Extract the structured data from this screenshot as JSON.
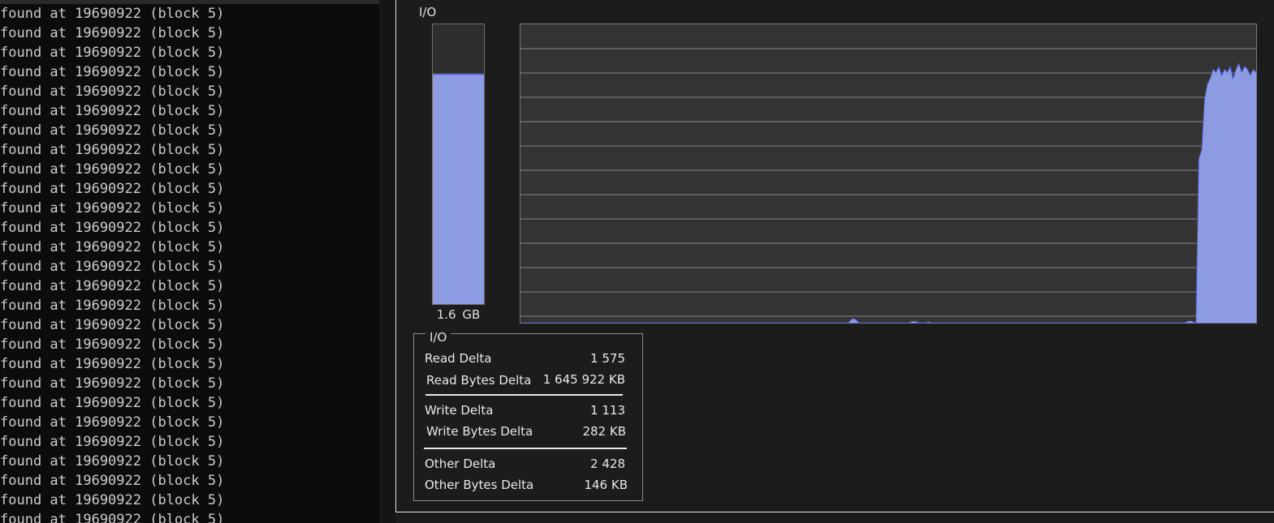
{
  "console": {
    "lines": [
      "found at 19690922 (block 5)",
      "found at 19690922 (block 5)",
      "found at 19690922 (block 5)",
      "found at 19690922 (block 5)",
      "found at 19690922 (block 5)",
      "found at 19690922 (block 5)",
      "found at 19690922 (block 5)",
      "found at 19690922 (block 5)",
      "found at 19690922 (block 5)",
      "found at 19690922 (block 5)",
      "found at 19690922 (block 5)",
      "found at 19690922 (block 5)",
      "found at 19690922 (block 5)",
      "found at 19690922 (block 5)",
      "found at 19690922 (block 5)",
      "found at 19690922 (block 5)",
      "found at 19690922 (block 5)",
      "found at 19690922 (block 5)",
      "found at 19690922 (block 5)",
      "found at 19690922 (block 5)",
      "found at 19690922 (block 5)",
      "found at 19690922 (block 5)",
      "found at 19690922 (block 5)",
      "found at 19690922 (block 5)",
      "found at 19690922 (block 5)",
      "found at 19690922 (block 5)",
      "found at 19690922 (block 5)"
    ]
  },
  "io": {
    "heading": "I/O",
    "meter": {
      "label": "1.6  GB",
      "fill_fraction": 0.82
    },
    "groupbox_title": "I/O",
    "stats": {
      "read_delta": {
        "label": "Read Delta",
        "value": "1 575"
      },
      "read_bytes_delta": {
        "label": "Read Bytes Delta",
        "value": "1 645 922 KB"
      },
      "write_delta": {
        "label": "Write Delta",
        "value": "1 113"
      },
      "write_bytes_delta": {
        "label": "Write Bytes Delta",
        "value": "282 KB"
      },
      "other_delta": {
        "label": "Other Delta",
        "value": "2 428"
      },
      "other_bytes_delta": {
        "label": "Other Bytes Delta",
        "value": "146 KB"
      }
    }
  },
  "graph": {
    "fill_color": "#8d9be3",
    "line_color": "#3a48c8",
    "spike_color": "#cc3388",
    "grid_color": "#8a8a8a",
    "background": "#333333",
    "gridlines": 12,
    "samples": [
      0,
      0,
      0,
      0,
      0,
      0,
      0,
      0,
      0,
      0,
      0,
      0,
      0,
      0,
      0,
      0,
      0,
      0,
      0,
      0,
      0,
      0,
      0,
      0,
      0,
      0,
      0,
      0,
      0,
      0,
      0,
      0,
      0,
      0,
      0,
      0,
      0,
      0,
      0,
      0,
      0,
      0,
      0,
      0,
      0,
      0,
      0,
      0,
      0,
      0,
      0,
      0,
      0,
      0,
      0,
      0,
      0,
      0,
      0,
      0,
      0,
      0,
      0,
      0,
      0,
      0,
      0,
      0,
      0,
      0,
      0,
      0,
      0,
      0,
      0,
      0,
      0,
      0,
      0,
      0,
      0,
      0,
      0,
      0,
      0,
      0,
      0,
      0,
      0,
      0,
      0,
      0,
      0,
      0,
      0,
      0,
      0,
      0,
      0,
      0,
      0,
      0,
      0,
      0,
      0,
      0,
      0,
      0,
      0,
      0,
      0,
      0,
      0,
      0,
      0,
      0.01,
      0.015,
      0.008,
      0,
      0,
      0,
      0,
      0,
      0,
      0,
      0,
      0,
      0,
      0,
      0,
      0,
      0,
      0,
      0,
      0,
      0,
      0.004,
      0.006,
      0.003,
      0,
      0,
      0,
      0.004,
      0,
      0,
      0,
      0,
      0,
      0,
      0,
      0,
      0,
      0,
      0,
      0,
      0,
      0,
      0,
      0,
      0,
      0,
      0,
      0,
      0,
      0,
      0,
      0,
      0,
      0,
      0,
      0,
      0,
      0,
      0,
      0,
      0,
      0,
      0,
      0,
      0,
      0,
      0,
      0,
      0,
      0,
      0,
      0,
      0,
      0,
      0,
      0,
      0,
      0,
      0,
      0,
      0,
      0,
      0,
      0,
      0,
      0,
      0,
      0,
      0,
      0,
      0,
      0,
      0,
      0,
      0,
      0,
      0,
      0,
      0,
      0,
      0,
      0,
      0,
      0,
      0,
      0,
      0,
      0,
      0,
      0,
      0,
      0,
      0,
      0,
      0,
      0,
      0,
      0.004,
      0.007,
      0.004,
      0,
      0.55,
      0.58,
      0.75,
      0.8,
      0.82,
      0.85,
      0.84,
      0.86,
      0.83,
      0.85,
      0.84,
      0.86,
      0.82,
      0.85,
      0.87,
      0.84,
      0.86,
      0.85,
      0.83,
      0.85,
      0.84
    ]
  }
}
